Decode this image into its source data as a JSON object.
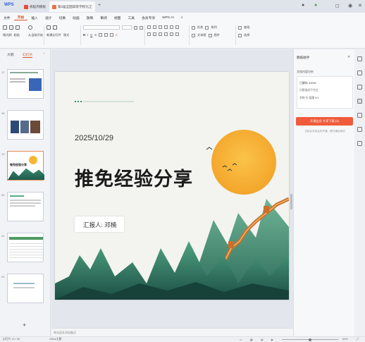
{
  "tabs": {
    "app": "WPS",
    "t1": "找稻壳模板",
    "t2": "第2届全国高等学校九江学院..."
  },
  "menu": [
    "文件",
    "开始",
    "插入",
    "设计",
    "切换",
    "动画",
    "放映",
    "审阅",
    "视图",
    "工具",
    "会员专享",
    "WPS AI"
  ],
  "menu_active_index": 1,
  "ribbon": {
    "format_painter": "格式刷",
    "paste": "粘贴",
    "clipboard_sep": "剪切",
    "copy": "复制",
    "from_current": "从当前开始",
    "new_slide": "新建幻灯片",
    "layout": "版式",
    "section": "节",
    "shape": "形状",
    "arrange": "排列",
    "textbox": "文本框",
    "picture": "图片",
    "find": "查找",
    "replace": "替换",
    "select": "选择"
  },
  "left_pane": {
    "tab_outline": "大纲",
    "tab_slides": "幻灯片",
    "add": "+"
  },
  "thumbs": [
    {
      "num": "17",
      "text": "..."
    },
    {
      "num": "18",
      "text": ""
    },
    {
      "num": "19",
      "text": "推免经验分享"
    },
    {
      "num": "20",
      "text": ""
    },
    {
      "num": "21",
      "text": ""
    },
    {
      "num": "22",
      "text": ""
    }
  ],
  "slide": {
    "date": "2025/10/29",
    "title": "推免经验分享",
    "reporter": "汇报人: 邓楠"
  },
  "notes_placeholder": "单击此处添加备注",
  "right_pane": {
    "title": "稿纸助手",
    "section": "文档内容分析",
    "doc_words": "已解析 400W",
    "line2": "问题描述不完全",
    "line3": "字符 行 段落 0/1",
    "action_button": "开通会员 专享下载 (1)",
    "hint": "当前会员权益未开通，需开通后使用"
  },
  "status": {
    "left": "幻灯片 19 / 36",
    "theme": "Office主题",
    "zoom": "64%"
  },
  "colors": {
    "accent": "#d7572b",
    "sun": "#f7b534",
    "mountain_dark": "#1f5a4d",
    "mountain_light": "#3a8f6f",
    "wall": "#c9702a",
    "button_red": "#ef5b3b"
  }
}
